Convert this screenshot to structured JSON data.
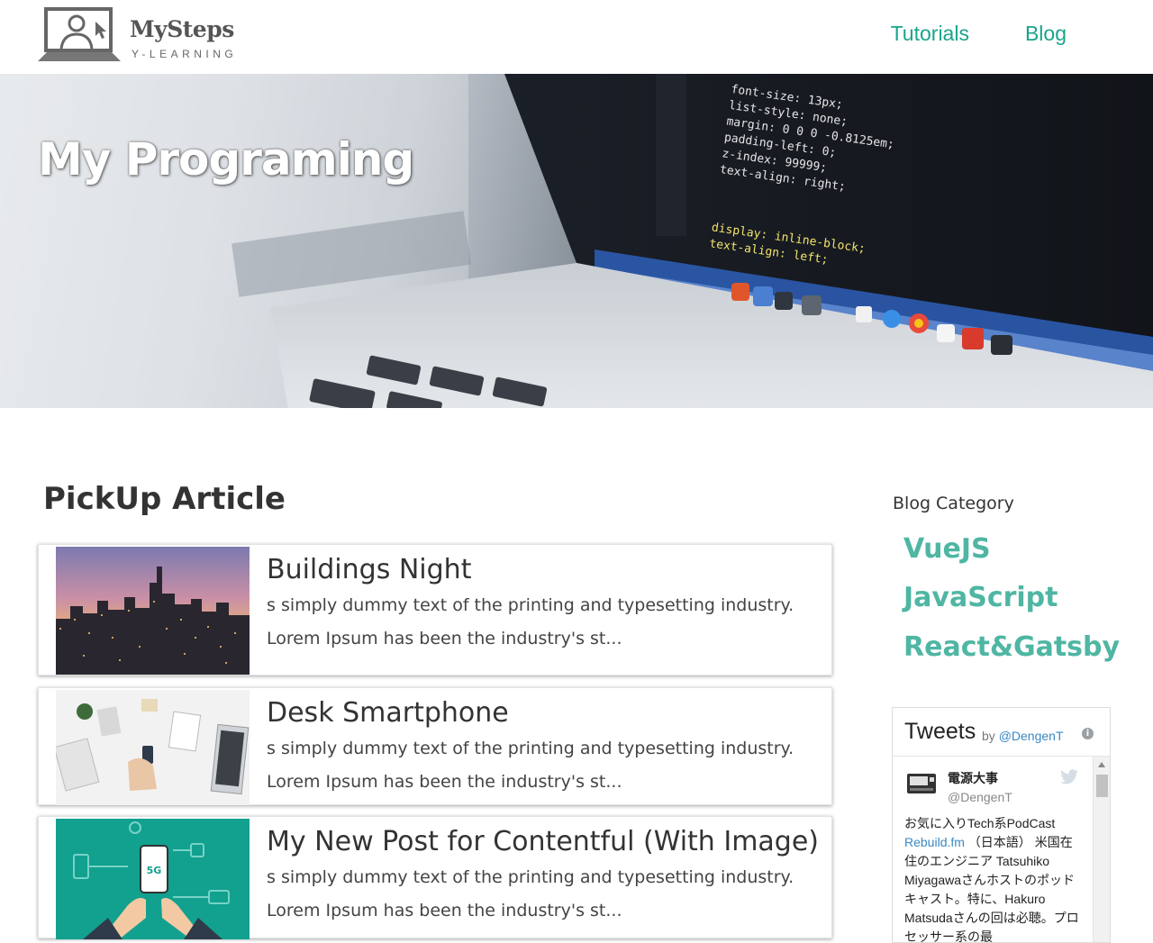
{
  "header": {
    "logo_title": "MySteps",
    "logo_subtitle": "Y-LEARNING",
    "nav": [
      {
        "label": "Tutorials"
      },
      {
        "label": "Blog"
      }
    ]
  },
  "hero": {
    "title": "My Programing",
    "code_lines": [
      "font-size: 13px;",
      "list-style: none;",
      "margin: 0 0 0 -0.8125em;",
      "padding-left: 0;",
      "z-index: 99999;",
      "text-align: right;",
      "display: inline-block;",
      "text-align: left;"
    ]
  },
  "main": {
    "section_title": "PickUp Article",
    "articles": [
      {
        "title": "Buildings Night",
        "excerpt_line1": "s simply dummy text of the printing and typesetting industry.",
        "excerpt_line2": "Lorem Ipsum has been the industry's st..."
      },
      {
        "title": "Desk Smartphone",
        "excerpt_line1": "s simply dummy text of the printing and typesetting industry.",
        "excerpt_line2": "Lorem Ipsum has been the industry's st..."
      },
      {
        "title": "My New Post for Contentful (With Image)",
        "excerpt_line1": "s simply dummy text of the printing and typesetting industry.",
        "excerpt_line2": "Lorem Ipsum has been the industry's st...",
        "thumb_badge": "5G"
      }
    ]
  },
  "sidebar": {
    "title": "Blog Category",
    "categories": [
      {
        "label": "VueJS"
      },
      {
        "label": "JavaScript"
      },
      {
        "label": "React&Gatsby"
      }
    ],
    "tweets": {
      "title": "Tweets",
      "by_prefix": "by ",
      "by_handle": "@DengenT",
      "info_glyph": "i",
      "tweet": {
        "name": "電源大事",
        "handle": "@DengenT",
        "text_part1": "お気に入りTech系PodCast ",
        "link": "Rebuild.fm",
        "text_part2": " （日本語） 米国在住のエンジニア Tatsuhiko Miyagawaさんホストのポッドキャスト。特に、Hakuro Matsudaさんの回は必聴。プロセッサー系の最"
      }
    }
  },
  "colors": {
    "accent": "#1aa48d",
    "category": "#4fb6a3",
    "link": "#3b88c3"
  }
}
